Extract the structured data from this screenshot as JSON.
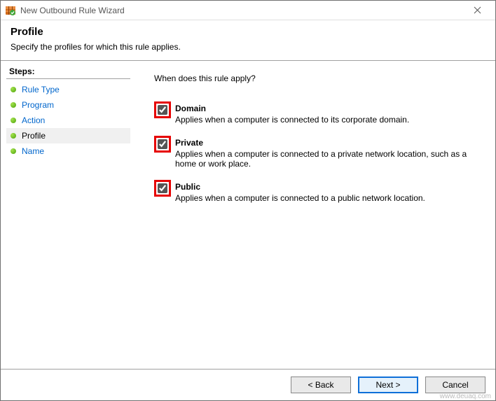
{
  "window": {
    "title": "New Outbound Rule Wizard"
  },
  "header": {
    "title": "Profile",
    "subtitle": "Specify the profiles for which this rule applies."
  },
  "steps": {
    "heading": "Steps:",
    "items": [
      {
        "label": "Rule Type",
        "current": false
      },
      {
        "label": "Program",
        "current": false
      },
      {
        "label": "Action",
        "current": false
      },
      {
        "label": "Profile",
        "current": true
      },
      {
        "label": "Name",
        "current": false
      }
    ]
  },
  "content": {
    "question": "When does this rule apply?",
    "options": [
      {
        "key": "domain",
        "label": "Domain",
        "description": "Applies when a computer is connected to its corporate domain.",
        "checked": true
      },
      {
        "key": "private",
        "label": "Private",
        "description": "Applies when a computer is connected to a private network location, such as a home or work place.",
        "checked": true
      },
      {
        "key": "public",
        "label": "Public",
        "description": "Applies when a computer is connected to a public network location.",
        "checked": true
      }
    ]
  },
  "buttons": {
    "back": "< Back",
    "next": "Next >",
    "cancel": "Cancel"
  },
  "watermark": "www.deuaq.com"
}
